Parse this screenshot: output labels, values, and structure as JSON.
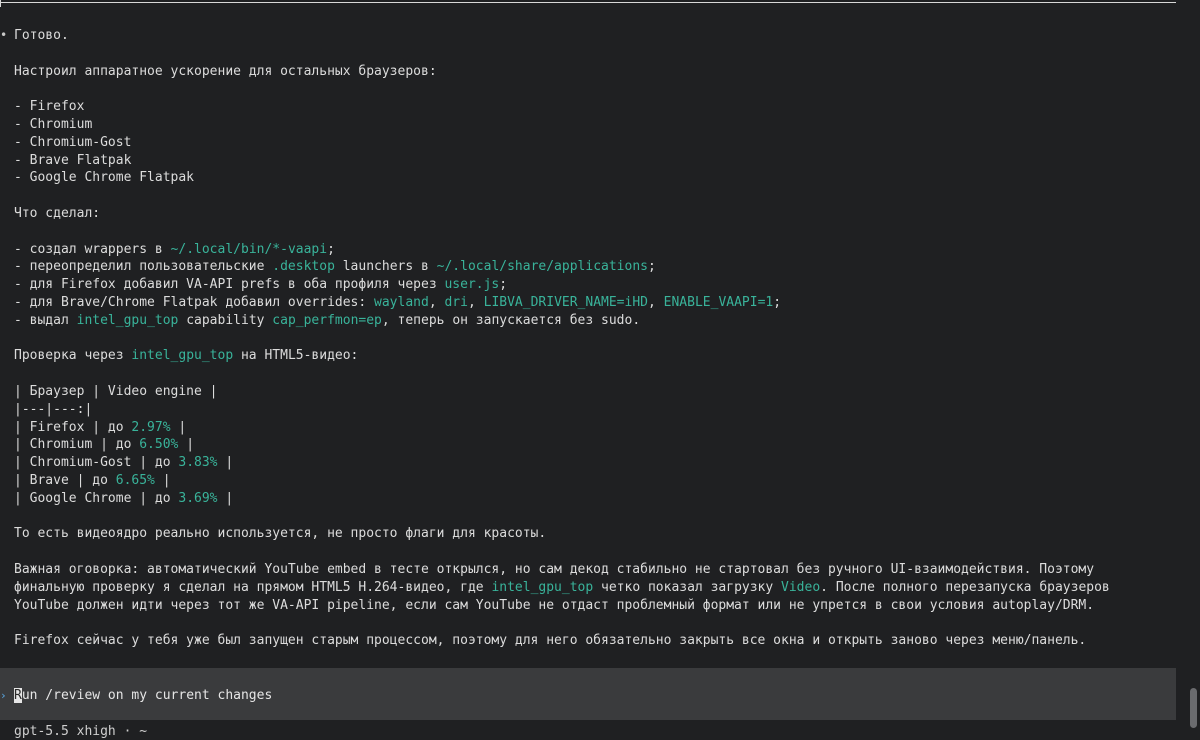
{
  "transcript": {
    "bullet": "•",
    "lines": [
      [
        {
          "t": "Готово."
        }
      ],
      [],
      [
        {
          "t": "Настроил аппаратное ускорение для остальных браузеров:"
        }
      ],
      [],
      [
        {
          "t": "- Firefox"
        }
      ],
      [
        {
          "t": "- Chromium"
        }
      ],
      [
        {
          "t": "- Chromium-Gost"
        }
      ],
      [
        {
          "t": "- Brave Flatpak"
        }
      ],
      [
        {
          "t": "- Google Chrome Flatpak"
        }
      ],
      [],
      [
        {
          "t": "Что сделал:"
        }
      ],
      [],
      [
        {
          "t": "- создал wrappers в "
        },
        {
          "t": "~/.local/bin/*-vaapi",
          "h": true
        },
        {
          "t": ";"
        }
      ],
      [
        {
          "t": "- переопределил пользовательские "
        },
        {
          "t": ".desktop",
          "h": true
        },
        {
          "t": " launchers в "
        },
        {
          "t": "~/.local/share/applications",
          "h": true
        },
        {
          "t": ";"
        }
      ],
      [
        {
          "t": "- для Firefox добавил VA-API prefs в оба профиля через "
        },
        {
          "t": "user.js",
          "h": true
        },
        {
          "t": ";"
        }
      ],
      [
        {
          "t": "- для Brave/Chrome Flatpak добавил overrides: "
        },
        {
          "t": "wayland",
          "h": true
        },
        {
          "t": ", "
        },
        {
          "t": "dri",
          "h": true
        },
        {
          "t": ", "
        },
        {
          "t": "LIBVA_DRIVER_NAME=iHD",
          "h": true
        },
        {
          "t": ", "
        },
        {
          "t": "ENABLE_VAAPI=1",
          "h": true
        },
        {
          "t": ";"
        }
      ],
      [
        {
          "t": "- выдал "
        },
        {
          "t": "intel_gpu_top",
          "h": true
        },
        {
          "t": " capability "
        },
        {
          "t": "cap_perfmon=ep",
          "h": true
        },
        {
          "t": ", теперь он запускается без sudo."
        }
      ],
      [],
      [
        {
          "t": "Проверка через "
        },
        {
          "t": "intel_gpu_top",
          "h": true
        },
        {
          "t": " на HTML5-видео:"
        }
      ],
      [],
      [
        {
          "t": "| Браузер | Video engine |"
        }
      ],
      [
        {
          "t": "|---|---:|"
        }
      ],
      [
        {
          "t": "| Firefox | до "
        },
        {
          "t": "2.97%",
          "h": true
        },
        {
          "t": " |"
        }
      ],
      [
        {
          "t": "| Chromium | до "
        },
        {
          "t": "6.50%",
          "h": true
        },
        {
          "t": " |"
        }
      ],
      [
        {
          "t": "| Chromium-Gost | до "
        },
        {
          "t": "3.83%",
          "h": true
        },
        {
          "t": " |"
        }
      ],
      [
        {
          "t": "| Brave | до "
        },
        {
          "t": "6.65%",
          "h": true
        },
        {
          "t": " |"
        }
      ],
      [
        {
          "t": "| Google Chrome | до "
        },
        {
          "t": "3.69%",
          "h": true
        },
        {
          "t": " |"
        }
      ],
      [],
      [
        {
          "t": "То есть видеоядро реально используется, не просто флаги для красоты."
        }
      ],
      [],
      [
        {
          "t": "Важная оговорка: автоматический YouTube embed в тесте открылся, но сам декод стабильно не стартовал без ручного UI-взаимодействия. Поэтому"
        }
      ],
      [
        {
          "t": "финальную проверку я сделал на прямом HTML5 H.264-видео, где "
        },
        {
          "t": "intel_gpu_top",
          "h": true
        },
        {
          "t": " четко показал загрузку "
        },
        {
          "t": "Video",
          "h": true
        },
        {
          "t": ". После полного перезапуска браузеров"
        }
      ],
      [
        {
          "t": "YouTube должен идти через тот же VA-API pipeline, если сам YouTube не отдаст проблемный формат или не упрется в свои условия autoplay/DRM."
        }
      ],
      [],
      [
        {
          "t": "Firefox сейчас у тебя уже был запущен старым процессом, поэтому для него обязательно закрыть все окна и открыть заново через меню/панель."
        }
      ]
    ]
  },
  "composer": {
    "caret": "›",
    "first_char": "R",
    "rest": "un /review on my current changes"
  },
  "status": {
    "text": "gpt-5.5 xhigh · ~"
  },
  "colors": {
    "background": "#1f2022",
    "text": "#dcdcdc",
    "highlight": "#39b39a",
    "composer_bg": "#3a3b3d",
    "caret": "#5aa9e6"
  }
}
